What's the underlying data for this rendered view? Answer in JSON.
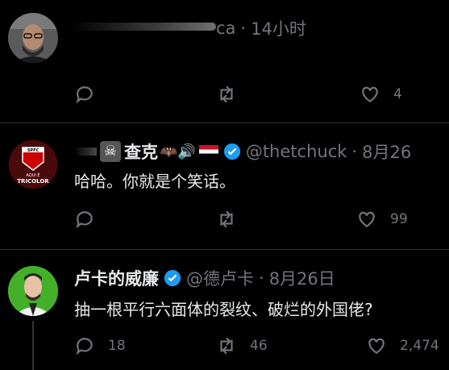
{
  "tweets": [
    {
      "author_partial": "ca",
      "time": "14小时",
      "actions": {
        "reply": "",
        "retweet": "",
        "like": "4"
      }
    },
    {
      "name": "查克",
      "emoji": "☠",
      "emoji_tail": "🦇🔊",
      "handle": "@thetchuck",
      "time": "8月26",
      "text": "哈哈。你就是个笑话。",
      "avatar_text": "SPFC\nAQUI É\nTRICOLOR",
      "actions": {
        "reply": "",
        "retweet": "",
        "like": "99"
      }
    },
    {
      "name": "卢卡的威廉",
      "handle": "@德卢卡",
      "time": "8月26日",
      "text": "抽一根平行六面体的裂纹、破烂的外国佬?",
      "actions": {
        "reply": "18",
        "retweet": "46",
        "like": "2,474"
      }
    }
  ],
  "colors": {
    "background": "#000000",
    "text": "#e7e9ea",
    "muted": "#71767b",
    "verified": "#1d9bf0",
    "divider": "#2f3336"
  }
}
